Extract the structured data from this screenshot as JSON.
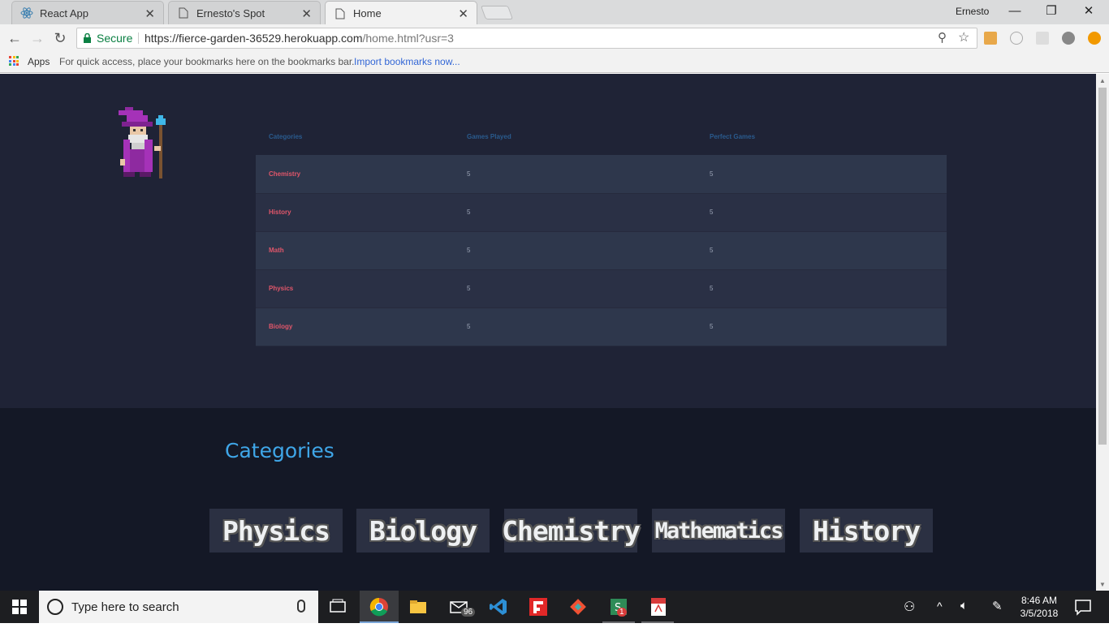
{
  "browser": {
    "tabs": [
      {
        "title": "React App"
      },
      {
        "title": "Ernesto's Spot"
      },
      {
        "title": "Home"
      }
    ],
    "profile_name": "Ernesto",
    "security_label": "Secure",
    "url_host": "https://fierce-garden-36529.herokuapp.com",
    "url_path": "/home.html?usr=3",
    "bookmarks": {
      "apps_label": "Apps",
      "hint": "For quick access, place your bookmarks here on the bookmarks bar.",
      "import_link": "Import bookmarks now..."
    }
  },
  "stats_table": {
    "headers": [
      "Categories",
      "Games Played",
      "Perfect Games"
    ],
    "rows": [
      {
        "category": "Chemistry",
        "played": "5",
        "perfect": "5"
      },
      {
        "category": "History",
        "played": "5",
        "perfect": "5"
      },
      {
        "category": "Math",
        "played": "5",
        "perfect": "5"
      },
      {
        "category": "Physics",
        "played": "5",
        "perfect": "5"
      },
      {
        "category": "Biology",
        "played": "5",
        "perfect": "5"
      }
    ]
  },
  "categories_section": {
    "heading": "Categories",
    "tiles": [
      "Physics",
      "Biology",
      "Chemistry",
      "Mathematics",
      "History"
    ]
  },
  "taskbar": {
    "search_placeholder": "Type here to search",
    "mail_badge": "96",
    "app_badge": "1",
    "time": "8:46 AM",
    "date": "3/5/2018"
  },
  "colors": {
    "page_bg": "#1f2336",
    "footer_bg": "#141826",
    "accent_blue": "#3fa6e8",
    "category_red": "#e0566a"
  }
}
